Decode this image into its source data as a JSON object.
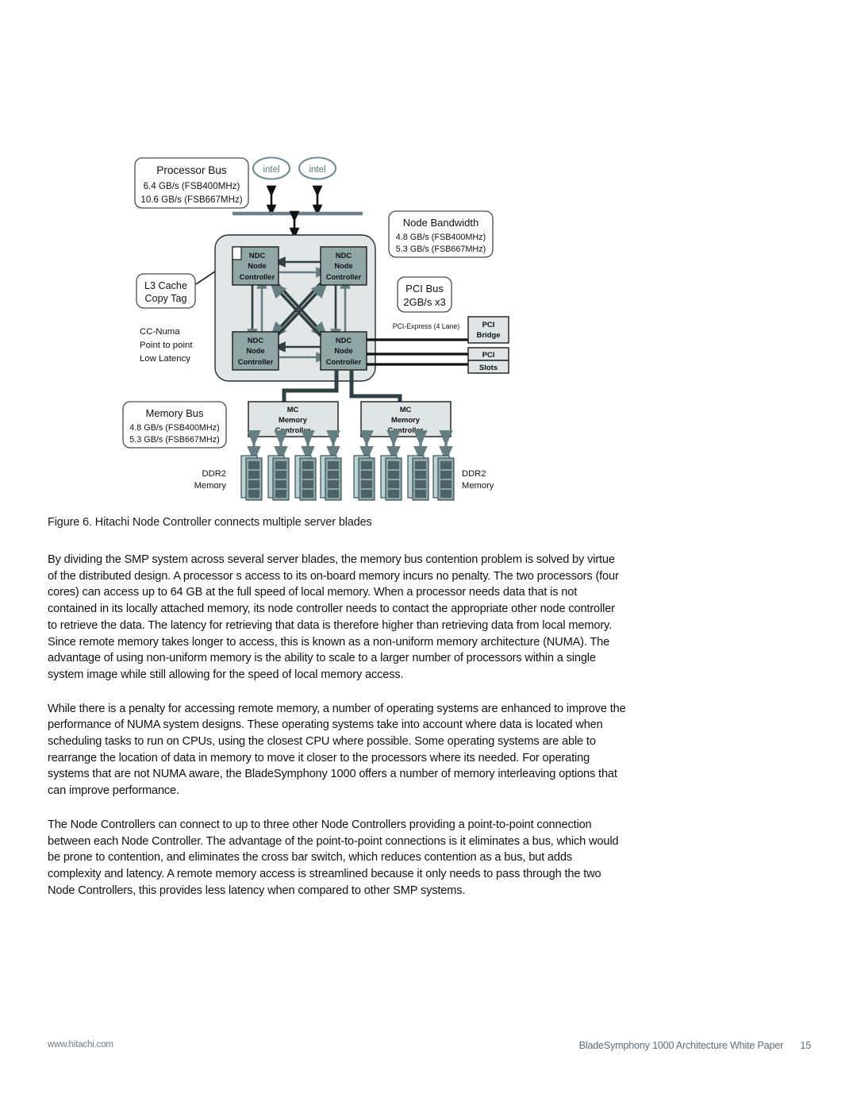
{
  "figure": {
    "callouts": {
      "processor_bus": {
        "title": "Processor Bus",
        "line1": "6.4 GB/s (FSB400MHz)",
        "line2": "10.6 GB/s (FSB667MHz)"
      },
      "node_bandwidth": {
        "title": "Node Bandwidth",
        "line1": "4.8 GB/s (FSB400MHz)",
        "line2": "5.3 GB/s (FSB667MHz)"
      },
      "pci_bus": {
        "title": "PCI Bus",
        "line1": "2GB/s x3"
      },
      "memory_bus": {
        "title": "Memory Bus",
        "line1": "4.8 GB/s (FSB400MHz)",
        "line2": "5.3 GB/s (FSB667MHz)"
      },
      "l3_cache": {
        "line1": "L3 Cache",
        "line2": "Copy Tag"
      }
    },
    "notes": {
      "n1": "CC-Numa",
      "n2": "Point to point",
      "n3": "Low Latency"
    },
    "cpu_logos": [
      "intel",
      "intel"
    ],
    "ndc": {
      "abbr": "NDC",
      "line2": "Node",
      "line3": "Controller"
    },
    "mc": {
      "abbr": "MC",
      "line2": "Memory",
      "line3": "Controller"
    },
    "pci": {
      "bridge_line1": "PCI",
      "bridge_line2": "Bridge",
      "slots_line1": "PCI",
      "slots_line2": "Slots",
      "express_label": "PCI-Express (4 Lane)"
    },
    "memory": {
      "left_label_line1": "DDR2",
      "left_label_line2": "Memory",
      "right_label_line1": "DDR2",
      "right_label_line2": "Memory"
    },
    "colors": {
      "ndc_fill": "#8fa6a4",
      "box_light_fill": "#dfe4e4",
      "container_fill": "#e2e6e6",
      "arrow_dark": "#2f3f42",
      "arrow_mid": "#657e82",
      "bus_line": "#6b8088",
      "dimm_body": "#b9d2d4",
      "dimm_chip": "#4f6266",
      "intel_logo": "#6f8e97",
      "stroke": "#1a1a1a"
    }
  },
  "caption": "Figure 6. Hitachi Node Controller connects multiple server blades",
  "paragraphs": [
    "By dividing the SMP system across several server blades, the memory bus contention problem is solved by virtue of the distributed design. A processor s access to its on-board memory incurs no penalty. The two processors (four cores) can access up to 64 GB at the full speed of local memory. When a processor needs data that is not contained in its locally attached memory, its node controller needs to contact the appropriate other node controller to retrieve the data. The latency for retrieving that data is therefore higher than retrieving data from local memory. Since remote memory takes longer to access, this is known as a non-uniform memory architecture (NUMA). The advantage of using non-uniform memory is the ability to scale to a larger number of processors within a single system image while still allowing for the speed of local memory access.",
    "While there is a penalty for accessing remote memory, a number of operating systems are enhanced to improve the performance of NUMA system designs. These operating systems take into account where data is located when scheduling tasks to run on CPUs, using the closest CPU where possible. Some operating systems are able to rearrange the location of data in memory to move it closer to the processors where its needed. For operating systems that are not NUMA aware, the BladeSymphony 1000 offers a number of memory interleaving options that can improve performance.",
    "The Node Controllers can connect to up to three other Node Controllers providing a point-to-point connection between each Node Controller. The advantage of the point-to-point connections is it eliminates a bus, which would be prone to contention, and eliminates the cross bar switch, which reduces contention as a bus, but adds complexity and latency. A remote memory access is streamlined because it only needs to pass through the two Node Controllers, this provides less latency when compared to other SMP systems."
  ],
  "footer": {
    "left": "www.hitachi.com",
    "right": "BladeSymphony 1000 Architecture White Paper",
    "page": "15"
  }
}
